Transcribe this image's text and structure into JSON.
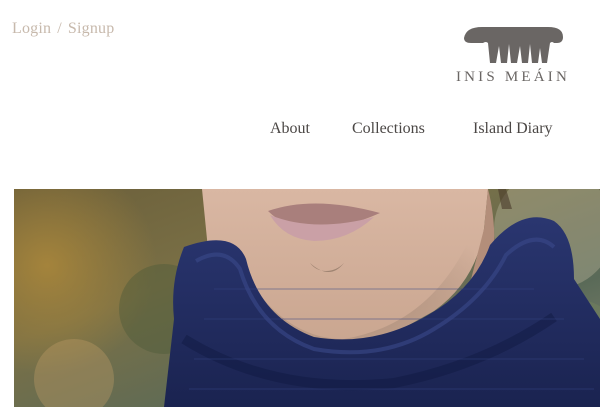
{
  "auth": {
    "login_label": "Login",
    "separator": "/",
    "signup_label": "Signup"
  },
  "brand": {
    "wordmark": "INIS MEÁIN",
    "logo_color": "#6a6664"
  },
  "nav": {
    "items": [
      {
        "label": "About"
      },
      {
        "label": "Collections"
      },
      {
        "label": "Island Diary"
      }
    ]
  },
  "hero": {
    "subject": "man wearing navy knit turtleneck sweater",
    "sweater_color": "#1f2a5a"
  },
  "colors": {
    "auth_text": "#c7b9ac",
    "nav_text": "#4b4745"
  }
}
